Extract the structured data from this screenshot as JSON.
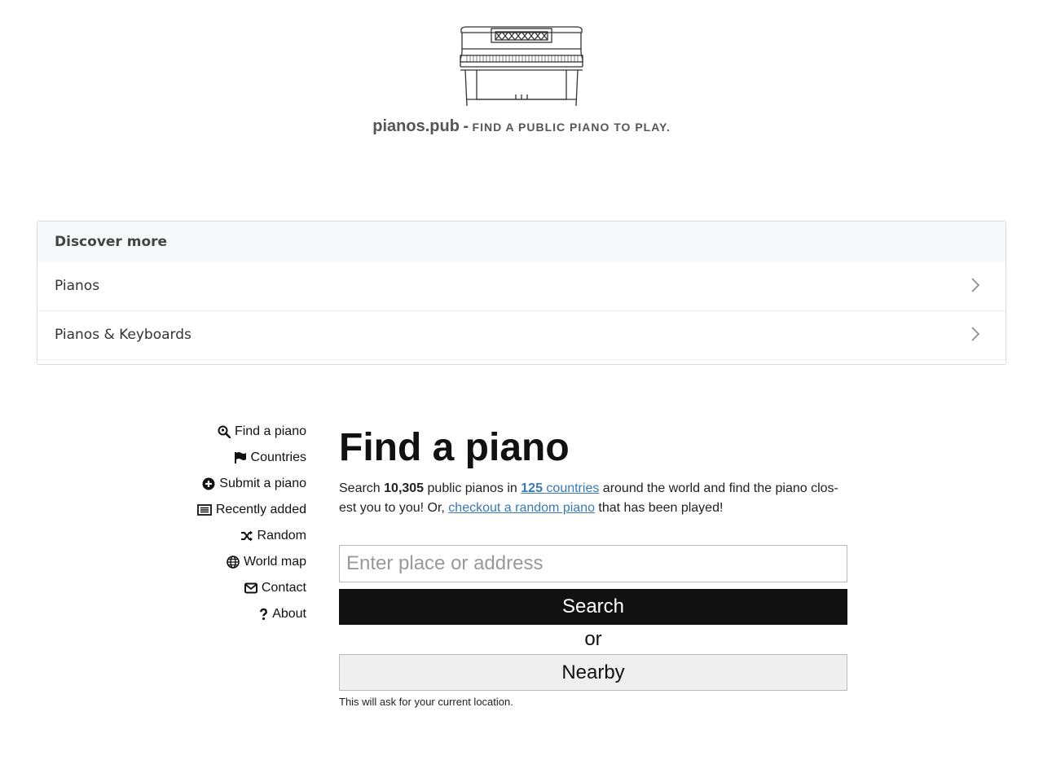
{
  "header": {
    "site_name": "pianos.pub",
    "separator": "-",
    "tagline": "Find a public piano to play."
  },
  "discover": {
    "title": "Discover more",
    "items": [
      {
        "label": "Pianos"
      },
      {
        "label": "Pianos & Keyboards"
      }
    ]
  },
  "nav": {
    "items": [
      {
        "label": "Find a piano",
        "icon": "search-location-icon"
      },
      {
        "label": "Countries",
        "icon": "flag-icon"
      },
      {
        "label": "Submit a piano",
        "icon": "plus-circle-icon"
      },
      {
        "label": "Recently added",
        "icon": "list-icon"
      },
      {
        "label": "Random",
        "icon": "shuffle-icon"
      },
      {
        "label": "World map",
        "icon": "globe-icon"
      },
      {
        "label": "Contact",
        "icon": "envelope-icon"
      },
      {
        "label": "About",
        "icon": "question-icon"
      }
    ]
  },
  "main": {
    "heading": "Find a piano",
    "intro_1": "Search ",
    "piano_count": "10,305",
    "intro_2": " public pianos in ",
    "country_count": "125",
    "countries_link": " countries",
    "intro_3": " around the world and find the piano clos-est you to you! Or, ",
    "random_link": "checkout a random piano",
    "intro_4": " that has been played!",
    "search_placeholder": "Enter place or address",
    "search_button": "Search",
    "or_text": "or",
    "nearby_button": "Nearby",
    "location_note": "This will ask for your current location."
  },
  "colors": {
    "link": "#3a79b4",
    "search_button_bg": "#111111",
    "nearby_button_bg": "#efefef"
  }
}
